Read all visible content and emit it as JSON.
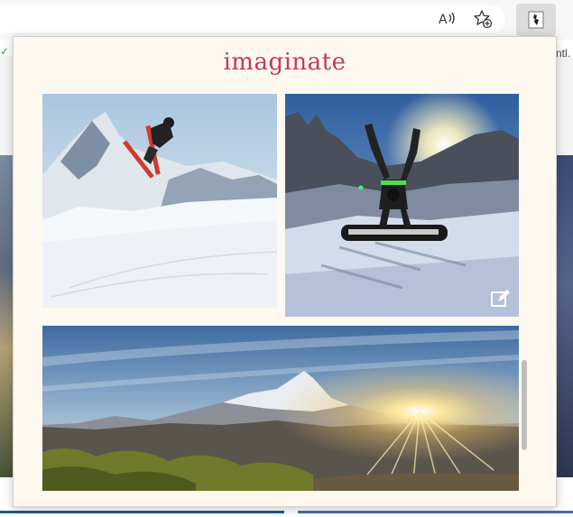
{
  "extension": {
    "title": "imaginate"
  },
  "background_page": {
    "partial_text": "ntl."
  },
  "toolbar": {
    "icons": [
      "read-aloud-icon",
      "add-favorite-icon",
      "extension-icon"
    ]
  },
  "colors": {
    "title": "#c43a5e",
    "popup_background": "#fdf8f0"
  },
  "photos": [
    {
      "subject": "skier-jump"
    },
    {
      "subject": "snowboarder-handstand"
    },
    {
      "subject": "mountain-sunset"
    }
  ]
}
